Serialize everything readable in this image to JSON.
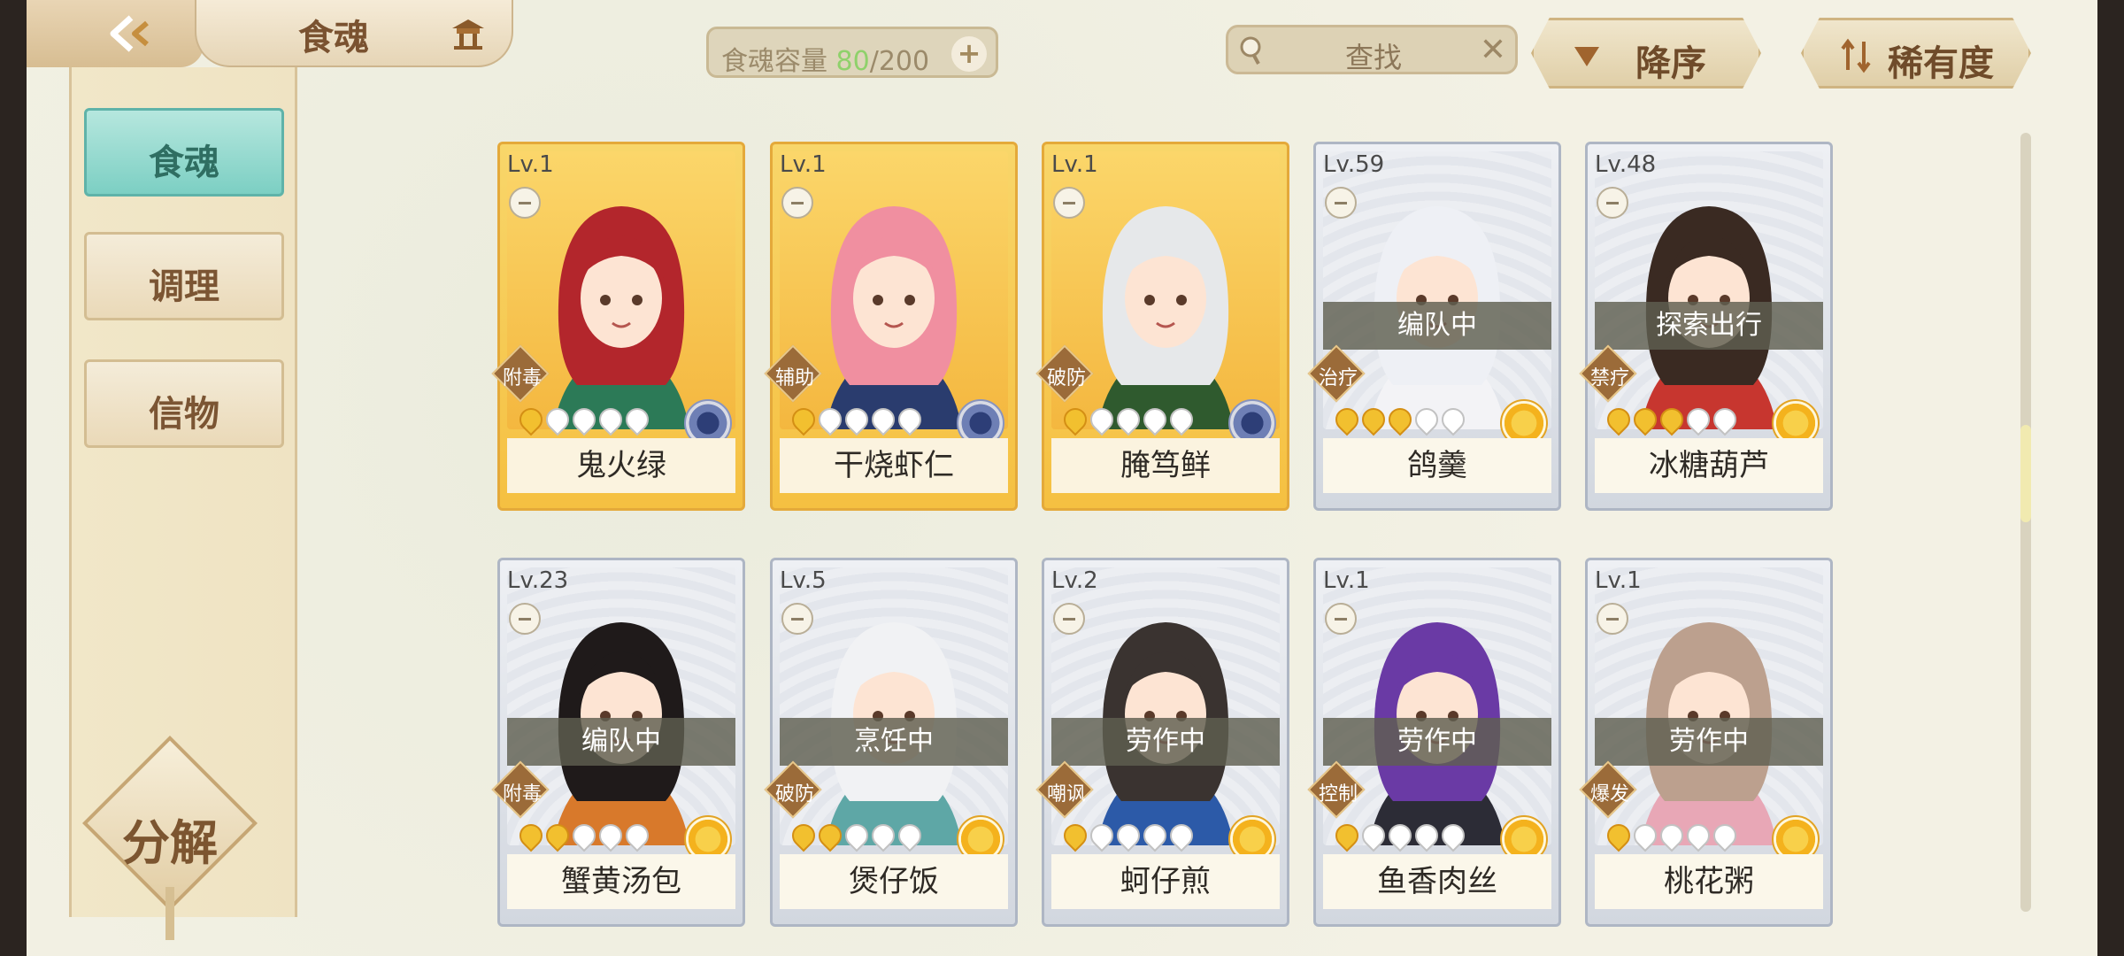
{
  "title_bar": {
    "title": "食魂"
  },
  "capacity": {
    "label": "食魂容量",
    "current": "80",
    "max": "/200",
    "plus": "+"
  },
  "search": {
    "placeholder": "查找",
    "clear": "✕"
  },
  "sort": {
    "order_label": "降序",
    "rarity_label": "稀有度"
  },
  "sidebar": {
    "items": [
      {
        "label": "食魂",
        "active": true
      },
      {
        "label": "调理",
        "active": false
      },
      {
        "label": "信物",
        "active": false
      }
    ],
    "decompose_label": "分解"
  },
  "cards": [
    {
      "level": "Lv.1",
      "name": "鬼火绿",
      "role": "附毒",
      "status": "",
      "stars": 1,
      "frame": "gold",
      "element": "blue",
      "hair": "#b3262c",
      "hair2": "#2c7a57"
    },
    {
      "level": "Lv.1",
      "name": "干烧虾仁",
      "role": "辅助",
      "status": "",
      "stars": 1,
      "frame": "gold",
      "element": "blue",
      "hair": "#f08fa0",
      "hair2": "#2a3c6e"
    },
    {
      "level": "Lv.1",
      "name": "腌笃鲜",
      "role": "破防",
      "status": "",
      "stars": 1,
      "frame": "gold",
      "element": "blue",
      "hair": "#e6e8ea",
      "hair2": "#2f5a2e"
    },
    {
      "level": "Lv.59",
      "name": "鸽羹",
      "role": "治疗",
      "status": "编队中",
      "stars": 3,
      "frame": "silver",
      "element": "gold",
      "hair": "#eef0f5",
      "hair2": "#f3f3f6"
    },
    {
      "level": "Lv.48",
      "name": "冰糖葫芦",
      "role": "禁疗",
      "status": "探索出行",
      "stars": 3,
      "frame": "silver",
      "element": "gold",
      "hair": "#3a2a22",
      "hair2": "#c7362f"
    },
    {
      "level": "Lv.23",
      "name": "蟹黄汤包",
      "role": "附毒",
      "status": "编队中",
      "stars": 2,
      "frame": "silver",
      "element": "gold",
      "hair": "#1f1a1a",
      "hair2": "#d8792b"
    },
    {
      "level": "Lv.5",
      "name": "煲仔饭",
      "role": "破防",
      "status": "烹饪中",
      "stars": 2,
      "frame": "silver",
      "element": "gold",
      "hair": "#f1f2f4",
      "hair2": "#5ea7a6"
    },
    {
      "level": "Lv.2",
      "name": "蚵仔煎",
      "role": "嘲讽",
      "status": "劳作中",
      "stars": 1,
      "frame": "silver",
      "element": "gold",
      "hair": "#3a3330",
      "hair2": "#2c5aa8"
    },
    {
      "level": "Lv.1",
      "name": "鱼香肉丝",
      "role": "控制",
      "status": "劳作中",
      "stars": 1,
      "frame": "silver",
      "element": "gold",
      "hair": "#6a3aa5",
      "hair2": "#2c2c36"
    },
    {
      "level": "Lv.1",
      "name": "桃花粥",
      "role": "爆发",
      "status": "劳作中",
      "stars": 1,
      "frame": "silver",
      "element": "gold",
      "hair": "#bca08e",
      "hair2": "#e8a7b6"
    }
  ]
}
